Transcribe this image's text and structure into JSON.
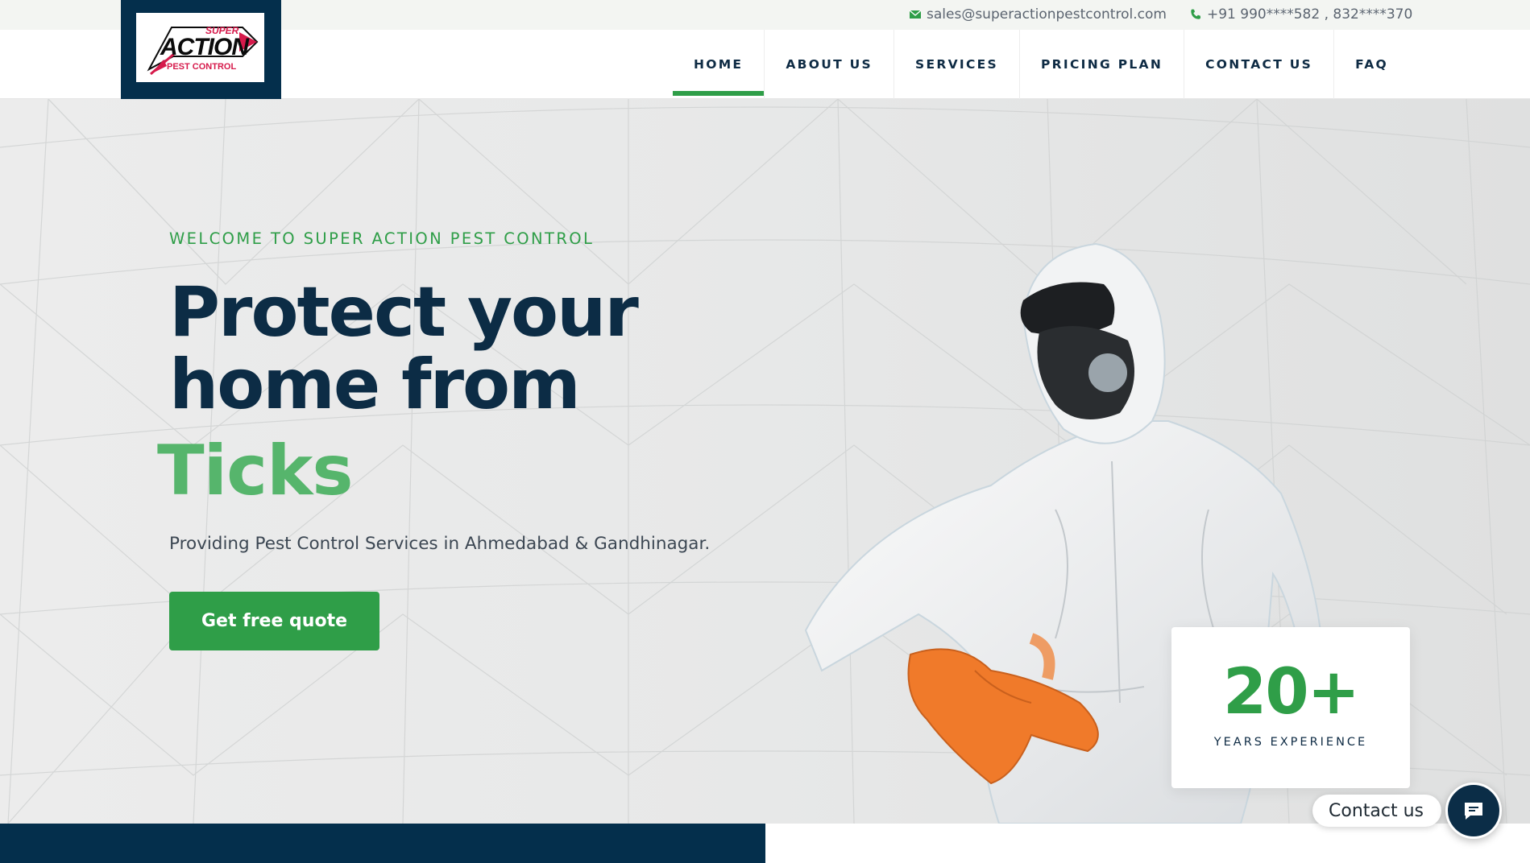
{
  "topbar": {
    "email": "sales@superactionpestcontrol.com",
    "phone": "+91 990****582 , 832****370",
    "email_icon": "envelope-icon",
    "phone_icon": "phone-icon"
  },
  "logo": {
    "line1": "SUPER",
    "line2": "ACTION",
    "line3": "PEST CONTROL"
  },
  "nav": {
    "items": [
      {
        "label": "HOME",
        "active": true
      },
      {
        "label": "ABOUT US",
        "active": false
      },
      {
        "label": "SERVICES",
        "active": false
      },
      {
        "label": "PRICING PLAN",
        "active": false
      },
      {
        "label": "CONTACT US",
        "active": false
      },
      {
        "label": "FAQ",
        "active": false
      }
    ]
  },
  "hero": {
    "welcome": "WELCOME TO SUPER ACTION PEST CONTROL",
    "headline_line1": "Protect your",
    "headline_line2": "home from",
    "headline_pest": "Ticks",
    "subtext": "Providing Pest Control Services in Ahmedabad & Gandhinagar.",
    "cta_label": "Get free quote"
  },
  "experience": {
    "number": "20+",
    "label": "YEARS EXPERIENCE"
  },
  "contact_widget": {
    "label": "Contact us",
    "icon": "chat-icon"
  },
  "colors": {
    "navy": "#042f4c",
    "green": "#2f9e48",
    "light_green": "#56b56c",
    "glove_orange": "#f07a2a"
  }
}
